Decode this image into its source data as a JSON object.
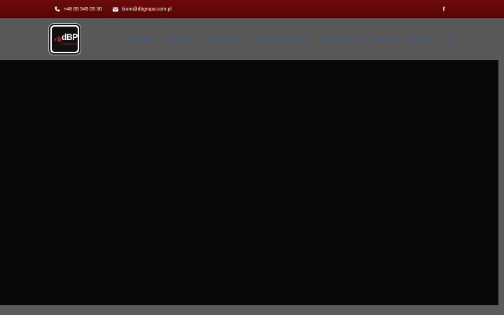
{
  "topbar": {
    "phone": "+48 65 545 05 30",
    "email": "biuro@dbgrupa.com.pl",
    "social_icon": "facebook-icon",
    "background_color": "#5a0606"
  },
  "logo": {
    "text": "dBP",
    "subtext": "PRODUCTS",
    "accent_color": "#c8102e"
  },
  "nav": {
    "items": [
      {
        "label": "O FIRMIE"
      },
      {
        "label": "OFERTA",
        "has_dropdown": true
      },
      {
        "label": "REALIZACJE"
      },
      {
        "label": "PARK MASZYNOWY"
      },
      {
        "label": "CERTYFIKATY"
      },
      {
        "label": "PRACA"
      },
      {
        "label": "KONTAKT"
      }
    ],
    "text_color": "#3d5a80",
    "search_icon": "search-icon"
  },
  "hero": {
    "background_color": "#080808"
  }
}
